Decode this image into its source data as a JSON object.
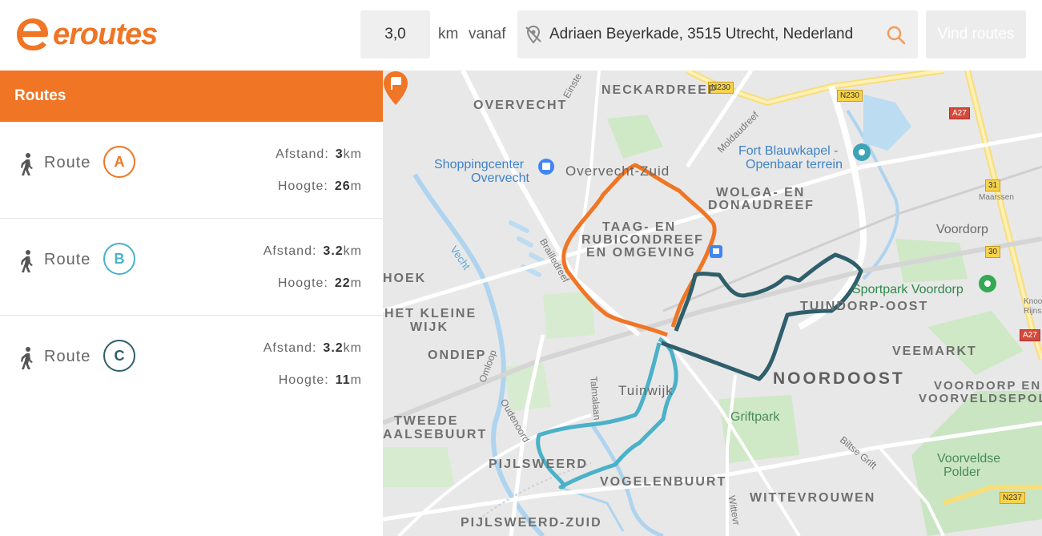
{
  "header": {
    "logo_text": "eroutes",
    "distance_value": "3,0",
    "distance_unit": "km",
    "from_label": "vanaf",
    "address_value": "Adriaen Beyerkade, 3515 Utrecht, Nederland",
    "find_button_label": "Vind routes"
  },
  "sidebar": {
    "title": "Routes",
    "distance_label": "Afstand:",
    "height_label": "Hoogte:",
    "routes": [
      {
        "label": "Route",
        "badge": "A",
        "distance": "3",
        "distance_unit": "km",
        "height": "26",
        "height_unit": "m",
        "color": "#f07524"
      },
      {
        "label": "Route",
        "badge": "B",
        "distance": "3.2",
        "distance_unit": "km",
        "height": "22",
        "height_unit": "m",
        "color": "#4bb1c8"
      },
      {
        "label": "Route",
        "badge": "C",
        "distance": "3.2",
        "distance_unit": "km",
        "height": "11",
        "height_unit": "m",
        "color": "#2e5f6b"
      }
    ]
  },
  "map": {
    "labels": {
      "overvecht": "OVERVECHT",
      "neckardreef": "NECKARDREEF",
      "shopping": "Shoppingcenter",
      "shopping2": "Overvecht",
      "overvecht_zuid": "Overvecht-Zuid",
      "fort1": "Fort Blauwkapel -",
      "fort2": "Openbaar terrein",
      "wolga1": "WOLGA- EN",
      "wolga2": "DONAUDREEF",
      "taag1": "TAAG- EN",
      "taag2": "RUBICONDREEF",
      "taag3": "EN OMGEVING",
      "voordorp": "Voordorp",
      "sportpark": "Sportpark Voordorp",
      "tuindorp": "TUINDORP-OOST",
      "hoek": "HOEK",
      "kleine1": "HET KLEINE",
      "kleine2": "WIJK",
      "ondiep": "ONDIEP",
      "veemarkt": "VEEMARKT",
      "noordoost": "NOORDOOST",
      "voordorp_p1": "VOORDORP EN",
      "voordorp_p2": "VOORVELDSEPOLD",
      "tuinwijk": "Tuinwijk",
      "griftpark": "Griftpark",
      "tweede1": "TWEEDE",
      "tweede2": "AALSEBUURT",
      "pijlsweerd": "PIJLSWEERD",
      "vogelenbuurt": "VOGELENBUURT",
      "wittevrouwen": "WITTEVROUWEN",
      "voorveldse1": "Voorveldse",
      "voorveldse2": "Polder",
      "pijlsweerd_zuid": "PIJLSWEERD-ZUID",
      "vecht": "Vecht",
      "braille": "Brailledreef",
      "einstein": "Einste",
      "moldau": "Moldaudreef",
      "omloop": "Omloop",
      "oudenoord": "Oudenoord",
      "talmalaan": "Talmalaan",
      "biltse": "Biltse Grift",
      "wittevrouwen_st": "Wittevr",
      "maarssen": "Maarssen",
      "knoop1": "Knoo",
      "knoop2": "Rijns"
    },
    "shields": {
      "n230a": "N230",
      "n230b": "N230",
      "a27a": "A27",
      "a27b": "A27",
      "s31": "31",
      "s30": "30",
      "n237": "N237"
    }
  }
}
